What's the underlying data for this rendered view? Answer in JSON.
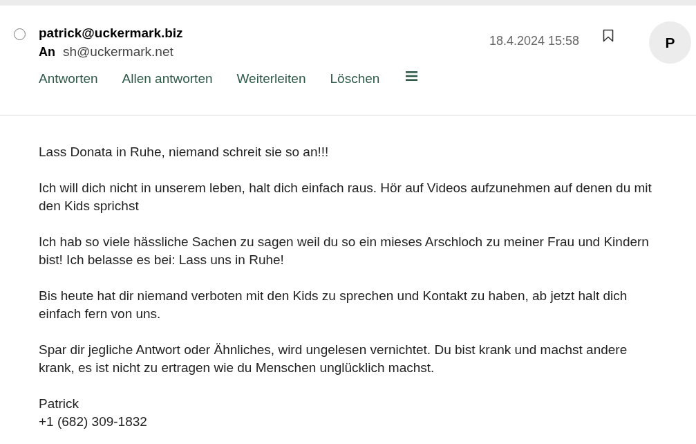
{
  "message": {
    "selected": false,
    "sender": "patrick@uckermark.biz",
    "recipient_label": "An",
    "recipient": "sh@uckermark.net",
    "date": "18.4.2024 15:58",
    "bookmarked": false,
    "avatar_initial": "P",
    "actions": [
      {
        "label": "Antworten"
      },
      {
        "label": "Allen antworten"
      },
      {
        "label": "Weiterleiten"
      },
      {
        "label": "Löschen"
      }
    ]
  },
  "body": {
    "paragraphs": [
      "Lass Donata in Ruhe, niemand schreit sie so an!!!",
      "Ich will dich nicht in unserem leben, halt dich einfach raus. Hör auf Videos aufzunehmen auf denen du mit den Kids sprichst",
      "Ich hab so viele hässliche Sachen zu sagen weil du so ein mieses Arschloch zu meiner Frau und Kindern bist! Ich belasse es bei: Lass uns in Ruhe!",
      "Bis heute hat dir niemand verboten mit den Kids zu sprechen und Kontakt zu haben, ab jetzt halt dich einfach fern von uns.",
      "Spar dir jegliche Antwort oder Ähnliches, wird ungelesen vernichtet. Du bist krank und machst andere krank, es ist nicht zu ertragen wie du Menschen unglücklich machst."
    ],
    "signature": [
      "Patrick",
      "+1 (682) 309-1832"
    ]
  }
}
